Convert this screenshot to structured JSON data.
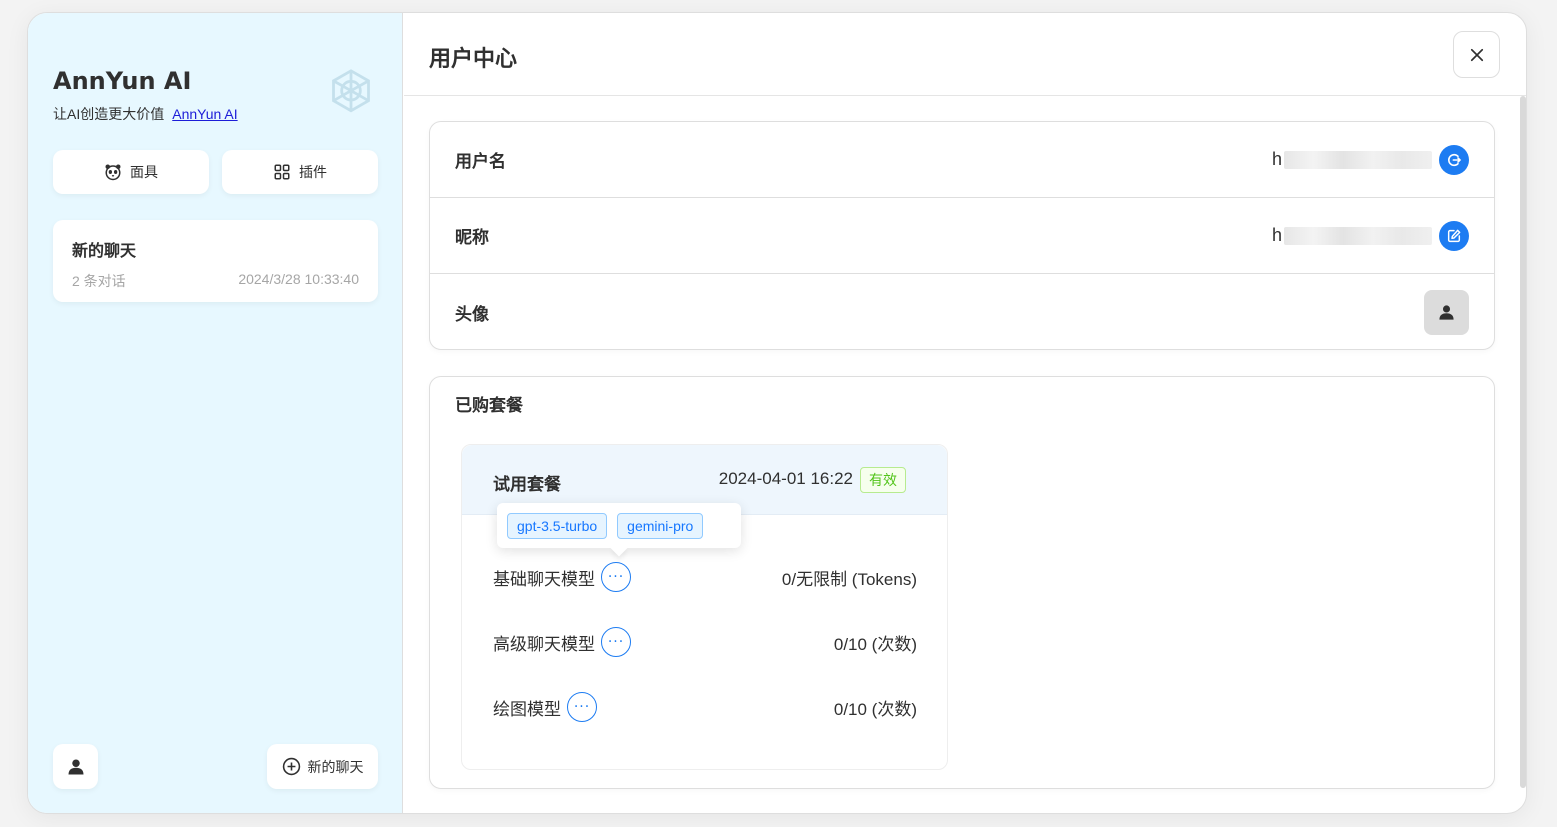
{
  "sidebar": {
    "title": "AnnYun AI",
    "subtitle": "让AI创造更大价值",
    "subtitle_link": "AnnYun AI",
    "buttons": {
      "mask": "面具",
      "plugin": "插件"
    },
    "chats": [
      {
        "title": "新的聊天",
        "count": "2 条对话",
        "time": "2024/3/28 10:33:40"
      }
    ],
    "new_chat": "新的聊天"
  },
  "main": {
    "title": "用户中心",
    "info": {
      "username_label": "用户名",
      "username_value": "h",
      "nickname_label": "昵称",
      "nickname_value": "h",
      "avatar_label": "头像"
    },
    "packages": {
      "title": "已购套餐",
      "items": [
        {
          "name": "试用套餐",
          "expire": "2024-04-01 16:22",
          "status": "有效",
          "tooltip_tags": [
            "gpt-3.5-turbo",
            "gemini-pro"
          ],
          "rows": [
            {
              "label": "基础聊天模型",
              "value": "0/无限制 (Tokens)"
            },
            {
              "label": "高级聊天模型",
              "value": "0/10 (次数)"
            },
            {
              "label": "绘图模型",
              "value": "0/10 (次数)"
            }
          ]
        }
      ]
    }
  },
  "colors": {
    "accent": "#1d7cf2",
    "sidebar_bg": "#e7f8ff",
    "valid": "#52c41a"
  },
  "icons": [
    "openai-logo-icon",
    "mask-icon",
    "plugin-grid-icon",
    "user-icon",
    "plus-circle-icon",
    "close-icon",
    "logout-icon",
    "edit-icon",
    "more-icon"
  ]
}
